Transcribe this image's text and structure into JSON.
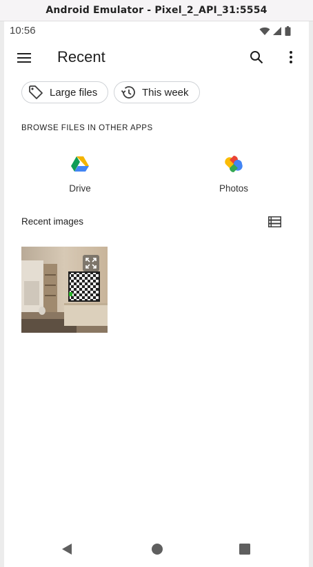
{
  "window": {
    "title": "Android Emulator - Pixel_2_API_31:5554"
  },
  "statusbar": {
    "time": "10:56",
    "icons": [
      "wifi-icon",
      "signal-icon",
      "battery-icon"
    ]
  },
  "appbar": {
    "title": "Recent",
    "icons": [
      "menu-icon",
      "search-icon",
      "more-vert-icon"
    ]
  },
  "chips": [
    {
      "label": "Large files",
      "icon": "tag-icon"
    },
    {
      "label": "This week",
      "icon": "history-icon"
    }
  ],
  "browse": {
    "header": "BROWSE FILES IN OTHER APPS",
    "apps": [
      {
        "label": "Drive",
        "icon": "drive-icon"
      },
      {
        "label": "Photos",
        "icon": "photos-icon"
      }
    ]
  },
  "recent_images": {
    "label": "Recent images",
    "view_toggle_icon": "list-view-icon",
    "items": [
      {
        "icon": "expand-icon"
      }
    ]
  },
  "navbar": {
    "icons": [
      "back-icon",
      "home-icon",
      "recents-icon"
    ]
  },
  "colors": {
    "drive_blue": "#4285f4",
    "drive_green": "#0f9d58",
    "drive_yellow": "#f4b400",
    "photos_red": "#ea4335",
    "text_primary": "#1f1f1f"
  }
}
